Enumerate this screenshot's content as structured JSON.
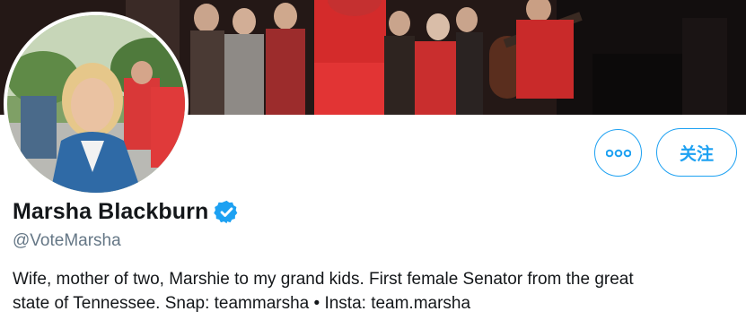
{
  "profile": {
    "display_name": "Marsha Blackburn",
    "handle": "@VoteMarsha",
    "bio_line1": "Wife, mother of two, Marshie to my grand kids. First female Senator from the great",
    "bio_line2": "state of Tennessee. Snap: teammarsha • Insta: team.marsha",
    "verified": true
  },
  "actions": {
    "more_icon": "more-dots-icon",
    "follow_label": "关注"
  },
  "colors": {
    "accent": "#1da1f2",
    "text": "#14171a",
    "secondary_text": "#657786"
  }
}
